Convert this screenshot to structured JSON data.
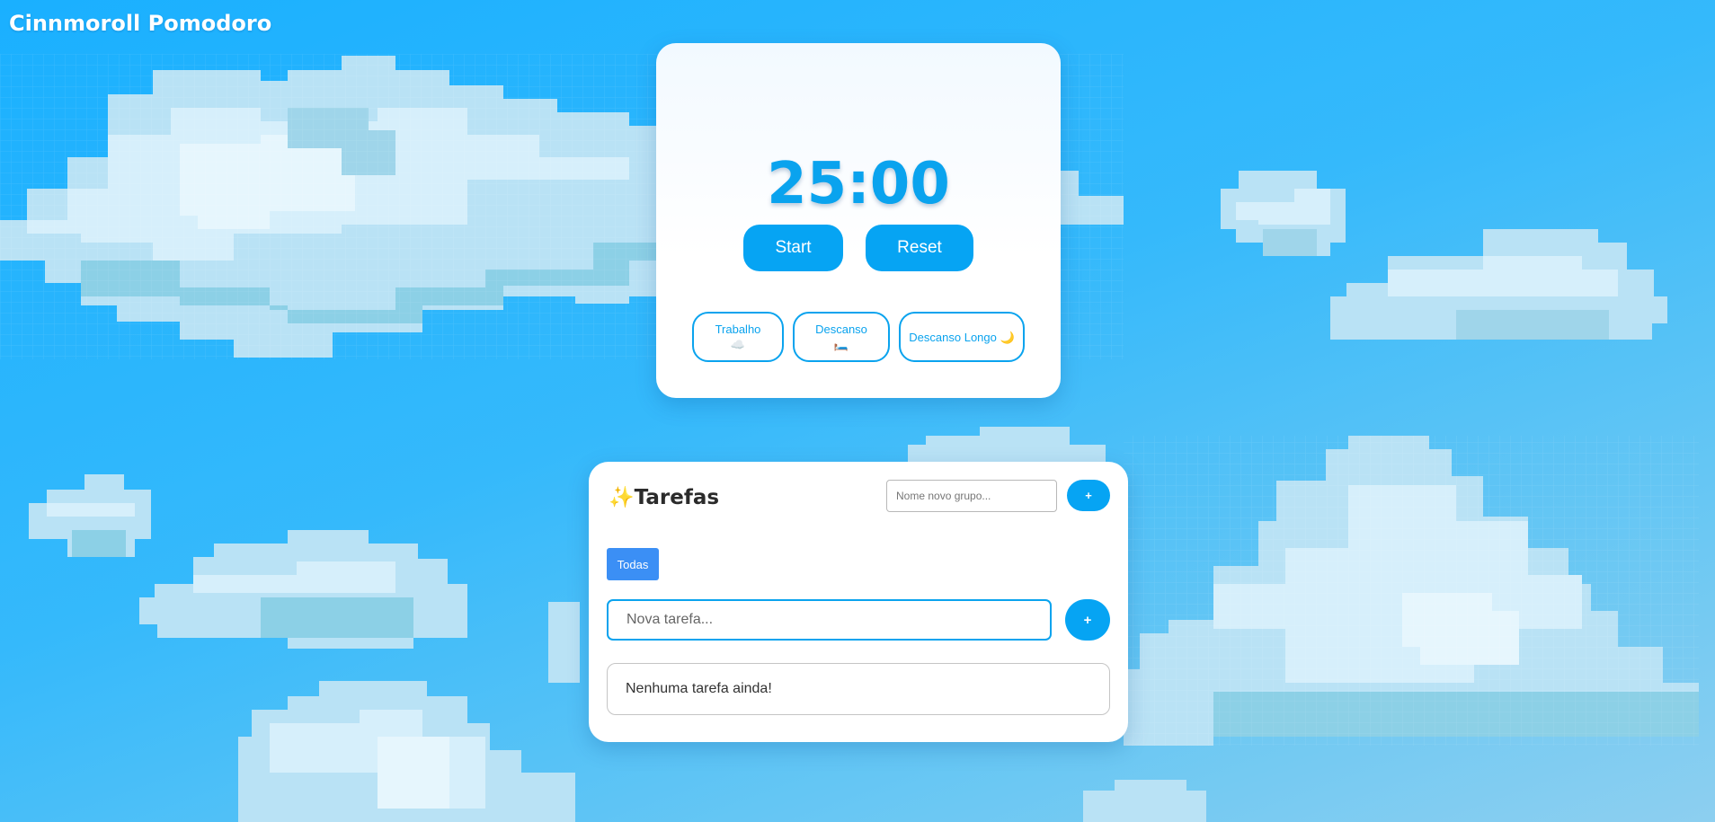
{
  "app": {
    "title": "Cinnmoroll Pomodoro"
  },
  "timer": {
    "display": "25:00",
    "start_label": "Start",
    "reset_label": "Reset",
    "modes": [
      {
        "name": "Trabalho",
        "emoji": "☁️"
      },
      {
        "name": "Descanso",
        "emoji": "🛏️"
      },
      {
        "name": "Descanso Longo",
        "emoji": "🌙"
      }
    ]
  },
  "tasks": {
    "heading_icon": "✨",
    "heading": "Tarefas",
    "new_group_placeholder": "Nome novo grupo...",
    "add_group_label": "+",
    "groups": [
      "Todas"
    ],
    "new_task_placeholder": "Nova tarefa...",
    "add_task_label": "+",
    "empty_message": "Nenhuma tarefa ainda!"
  },
  "colors": {
    "accent": "#06a4f3",
    "group_tab": "#3b8ff5",
    "timer_text": "#0aa3ee"
  }
}
